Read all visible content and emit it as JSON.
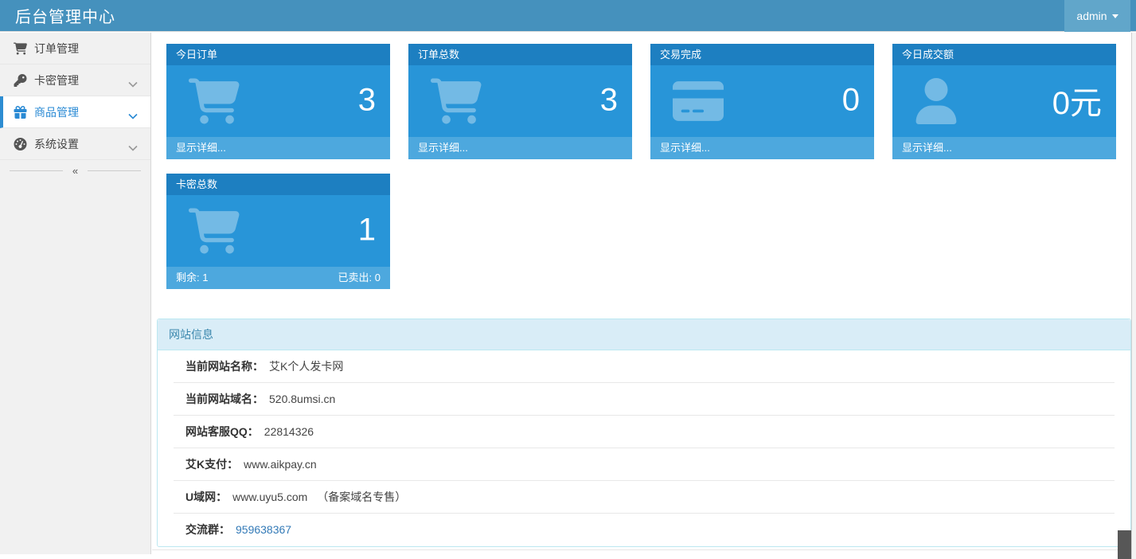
{
  "header": {
    "title": "后台管理中心",
    "user": {
      "name": "admin"
    }
  },
  "sidebar": {
    "items": [
      {
        "label": "订单管理",
        "icon": "cart-icon",
        "active": false,
        "has_children": false
      },
      {
        "label": "卡密管理",
        "icon": "key-icon",
        "active": false,
        "has_children": true
      },
      {
        "label": "商品管理",
        "icon": "gift-icon",
        "active": true,
        "has_children": true
      },
      {
        "label": "系统设置",
        "icon": "gauge-icon",
        "active": false,
        "has_children": true
      }
    ],
    "collapse_glyph": "«"
  },
  "stat_cards": [
    {
      "title": "今日订单",
      "value": "3",
      "icon": "cart-icon",
      "footer": "显示详细..."
    },
    {
      "title": "订单总数",
      "value": "3",
      "icon": "cart-icon",
      "footer": "显示详细..."
    },
    {
      "title": "交易完成",
      "value": "0",
      "icon": "credit-card-icon",
      "footer": "显示详细..."
    },
    {
      "title": "今日成交额",
      "value": "0元",
      "icon": "user-icon",
      "footer": "显示详细..."
    },
    {
      "title": "卡密总数",
      "value": "1",
      "icon": "cart-icon",
      "footer_left": "剩余: 1",
      "footer_right": "已卖出: 0"
    }
  ],
  "site_info": {
    "title": "网站信息",
    "rows": [
      {
        "label": "当前网站名称：",
        "value": "艾K个人发卡网"
      },
      {
        "label": "当前网站域名：",
        "value": "520.8umsi.cn"
      },
      {
        "label": "网站客服QQ：",
        "value": "22814326"
      },
      {
        "label": "艾K支付：",
        "value": "www.aikpay.cn"
      },
      {
        "label": "U域网：",
        "value": "www.uyu5.com",
        "note": "（备案域名专售）"
      },
      {
        "label": "交流群：",
        "value": "959638367"
      }
    ]
  },
  "colors": {
    "topbar": "#4591bd",
    "topbar_user_box": "#61a6ca",
    "card_header": "#1d7fc1",
    "card_body": "#2895d8",
    "card_footer": "#4da8de",
    "sidebar_bg": "#f1f1f1",
    "active_item": "#2a8ad4",
    "panel_border": "#bce8f1",
    "panel_heading_bg": "#d9edf7",
    "panel_heading_text": "#3a87ad",
    "link": "#337ab7"
  }
}
